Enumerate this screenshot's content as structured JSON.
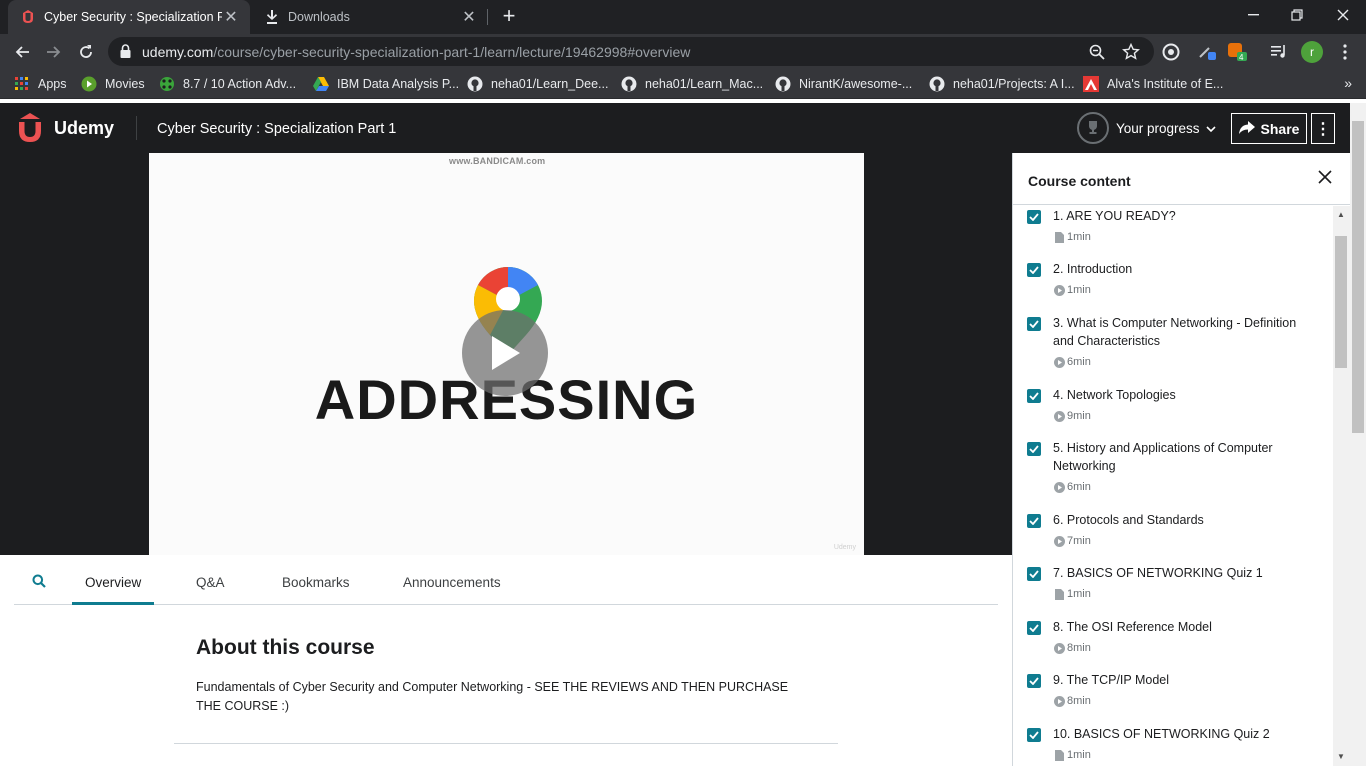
{
  "browser": {
    "tabs": [
      {
        "title": "Cyber Security : Specialization Pa",
        "favicon": "udemy-icon",
        "active": true
      },
      {
        "title": "Downloads",
        "favicon": "download-icon",
        "active": false
      }
    ],
    "url_host": "udemy.com",
    "url_path": "/course/cyber-security-specialization-part-1/learn/lecture/19462998#overview",
    "profile_initial": "r",
    "bookmarks": [
      {
        "label": "Apps",
        "icon": "apps-grid-icon"
      },
      {
        "label": "Movies",
        "icon": "movies-icon"
      },
      {
        "label": "8.7 / 10 Action Adv...",
        "icon": "rating-icon"
      },
      {
        "label": "IBM Data Analysis P...",
        "icon": "drive-icon"
      },
      {
        "label": "neha01/Learn_Dee...",
        "icon": "github-icon"
      },
      {
        "label": "neha01/Learn_Mac...",
        "icon": "github-icon"
      },
      {
        "label": "NirantK/awesome-...",
        "icon": "github-icon"
      },
      {
        "label": "neha01/Projects: A I...",
        "icon": "github-icon"
      },
      {
        "label": "Alva's Institute of E...",
        "icon": "college-icon"
      }
    ],
    "bookmarks_more": "»"
  },
  "header": {
    "logo_text": "Udemy",
    "course_title": "Cyber Security : Specialization Part 1",
    "progress_label": "Your progress",
    "share_label": "Share",
    "more_label": "⋮"
  },
  "video": {
    "watermark": "www.BANDICAM.com",
    "slide_text": "ADDRESSING",
    "footer_mark": "Udemy"
  },
  "lecture_tabs": [
    {
      "label": "Overview",
      "active": true
    },
    {
      "label": "Q&A"
    },
    {
      "label": "Bookmarks"
    },
    {
      "label": "Announcements"
    }
  ],
  "about": {
    "heading": "About this course",
    "description": "Fundamentals of Cyber Security and Computer Networking - SEE THE REVIEWS AND THEN PURCHASE THE COURSE :)"
  },
  "sidebar": {
    "title": "Course content",
    "items": [
      {
        "title": "1. ARE YOU READY?",
        "type": "document",
        "duration": "1min",
        "checked": true
      },
      {
        "title": "2. Introduction",
        "type": "video",
        "duration": "1min",
        "checked": true
      },
      {
        "title": "3. What is Computer Networking - Definition and Characteristics",
        "type": "video",
        "duration": "6min",
        "checked": true
      },
      {
        "title": "4. Network Topologies",
        "type": "video",
        "duration": "9min",
        "checked": true
      },
      {
        "title": "5. History and Applications of Computer Networking",
        "type": "video",
        "duration": "6min",
        "checked": true
      },
      {
        "title": "6. Protocols and Standards",
        "type": "video",
        "duration": "7min",
        "checked": true
      },
      {
        "title": "7. BASICS OF NETWORKING Quiz 1",
        "type": "document",
        "duration": "1min",
        "checked": true
      },
      {
        "title": "8. The OSI Reference Model",
        "type": "video",
        "duration": "8min",
        "checked": true
      },
      {
        "title": "9. The TCP/IP Model",
        "type": "video",
        "duration": "8min",
        "checked": true
      },
      {
        "title": "10. BASICS OF NETWORKING Quiz 2",
        "type": "document",
        "duration": "1min",
        "checked": true
      }
    ]
  },
  "colors": {
    "accent_teal": "#0f7c90",
    "udemy_red": "#ec5252",
    "header_bg": "#1c1d1f"
  }
}
